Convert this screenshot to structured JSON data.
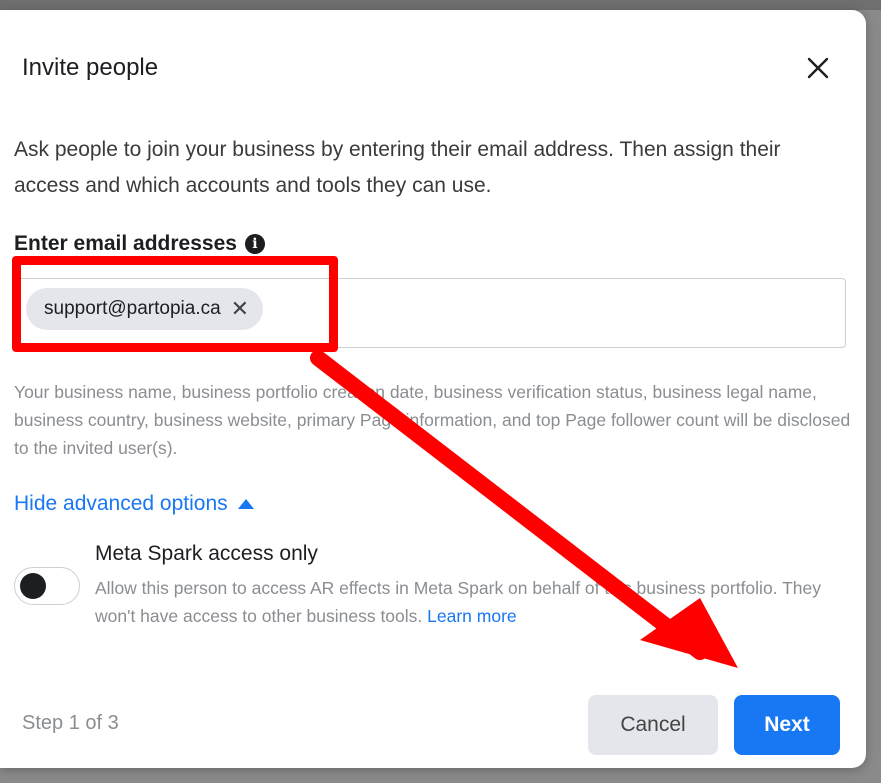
{
  "dialog": {
    "title": "Invite people",
    "close_icon": "close-icon",
    "description": "Ask people to join your business by entering their email address. Then assign their access and which accounts and tools they can use.",
    "email_label": "Enter email addresses",
    "info_icon_glyph": "i",
    "email_chip": "support@partopia.ca",
    "disclosure": "Your business name, business portfolio creation date, business verification status, business legal name, business country, business website, primary Page information, and top Page follower count will be disclosed to the invited user(s).",
    "advanced_toggle": "Hide advanced options",
    "spark": {
      "title": "Meta Spark access only",
      "description": "Allow this person to access AR effects in Meta Spark on behalf of this business portfolio. They won't have access to other business tools.",
      "learn_more": "Learn more",
      "toggle_on": false
    },
    "step": "Step 1 of 3",
    "cancel": "Cancel",
    "next": "Next"
  },
  "colors": {
    "primary": "#1877f2",
    "annotation": "#ff0000"
  }
}
